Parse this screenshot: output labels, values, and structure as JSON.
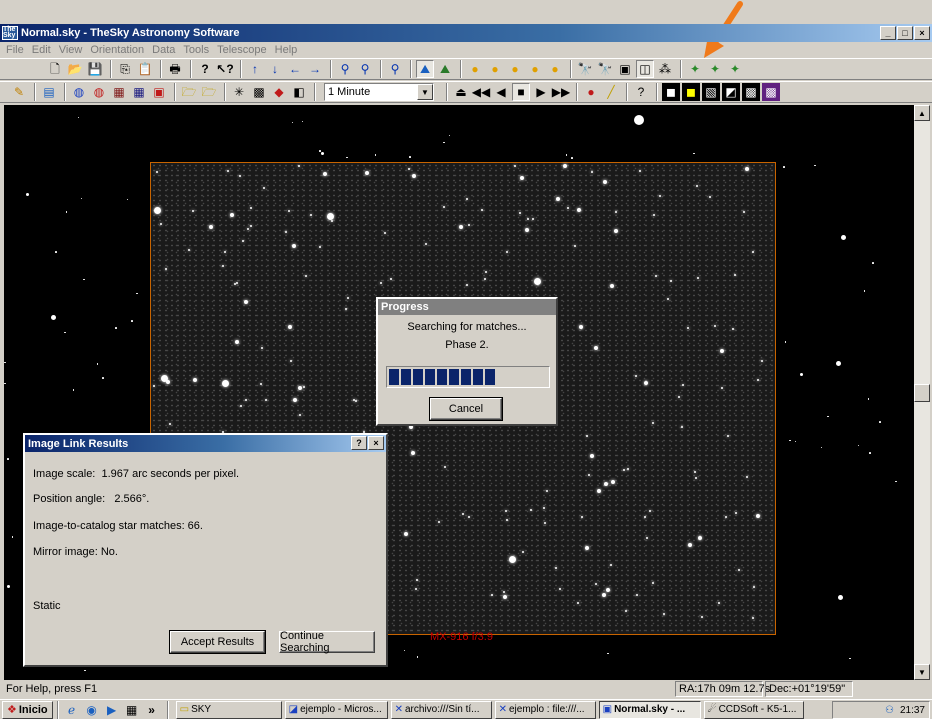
{
  "window": {
    "title": "Normal.sky - TheSky Astronomy Software",
    "app_icon_text": "The Sky",
    "buttons": [
      "_",
      "□",
      "×"
    ]
  },
  "menu": [
    "File",
    "Edit",
    "View",
    "Orientation",
    "Data",
    "Tools",
    "Telescope",
    "Help"
  ],
  "toolbar1_icons": [
    "new",
    "open",
    "save",
    "copy",
    "paste",
    "print",
    "help",
    "whats-this",
    "up",
    "down",
    "left",
    "right",
    "zoom-in",
    "zoom-out",
    "find",
    "horizon",
    "ground",
    "sun",
    "moon",
    "planet",
    "planet2",
    "info",
    "telescope1",
    "telescope2",
    "ccd1",
    "image-link",
    "image-link-settings",
    "mount1",
    "mount2",
    "mount3"
  ],
  "toolbar2": {
    "time_step": "1 Minute",
    "time_step_options": [
      "1 Minute"
    ]
  },
  "sky": {
    "photo_caption": "MX-916 f/3.9"
  },
  "progress_dialog": {
    "title": "Progress",
    "line1": "Searching for matches...",
    "line2": "Phase 2.",
    "progress_fraction": 0.62,
    "segments": 9,
    "cancel_label": "Cancel"
  },
  "image_link_dialog": {
    "title": "Image Link Results",
    "help_btn": "?",
    "close_btn": "×",
    "scale_label": "Image scale:",
    "scale_value": "1.967 arc seconds per pixel.",
    "angle_label": "Position angle:",
    "angle_value": "2.566°.",
    "matches": "Image-to-catalog star matches: 66.",
    "mirror": "Mirror image: No.",
    "static_label": "Static",
    "accept_label": "Accept Results",
    "continue_label": "Continue Searching"
  },
  "status": {
    "help": "For Help, press F1",
    "ra": "RA:17h 09m 12.7s",
    "dec": "Dec:+01°19'59\""
  },
  "taskbar": {
    "start": "Inicio",
    "tasks": [
      {
        "label": "SKY",
        "active": false
      },
      {
        "label": "ejemplo - Micros...",
        "active": false
      },
      {
        "label": "archivo:///Sin tí...",
        "active": false
      },
      {
        "label": "ejemplo : file:///...",
        "active": false
      },
      {
        "label": "Normal.sky - ...",
        "active": true
      },
      {
        "label": "CCDSoft - K5-1...",
        "active": false
      }
    ],
    "clock": "21:37"
  },
  "colors": {
    "annotation_arrow": "#f07a1a",
    "title_gradient_start": "#0a246a",
    "photo_border": "#c86400",
    "caption": "#c80000"
  }
}
